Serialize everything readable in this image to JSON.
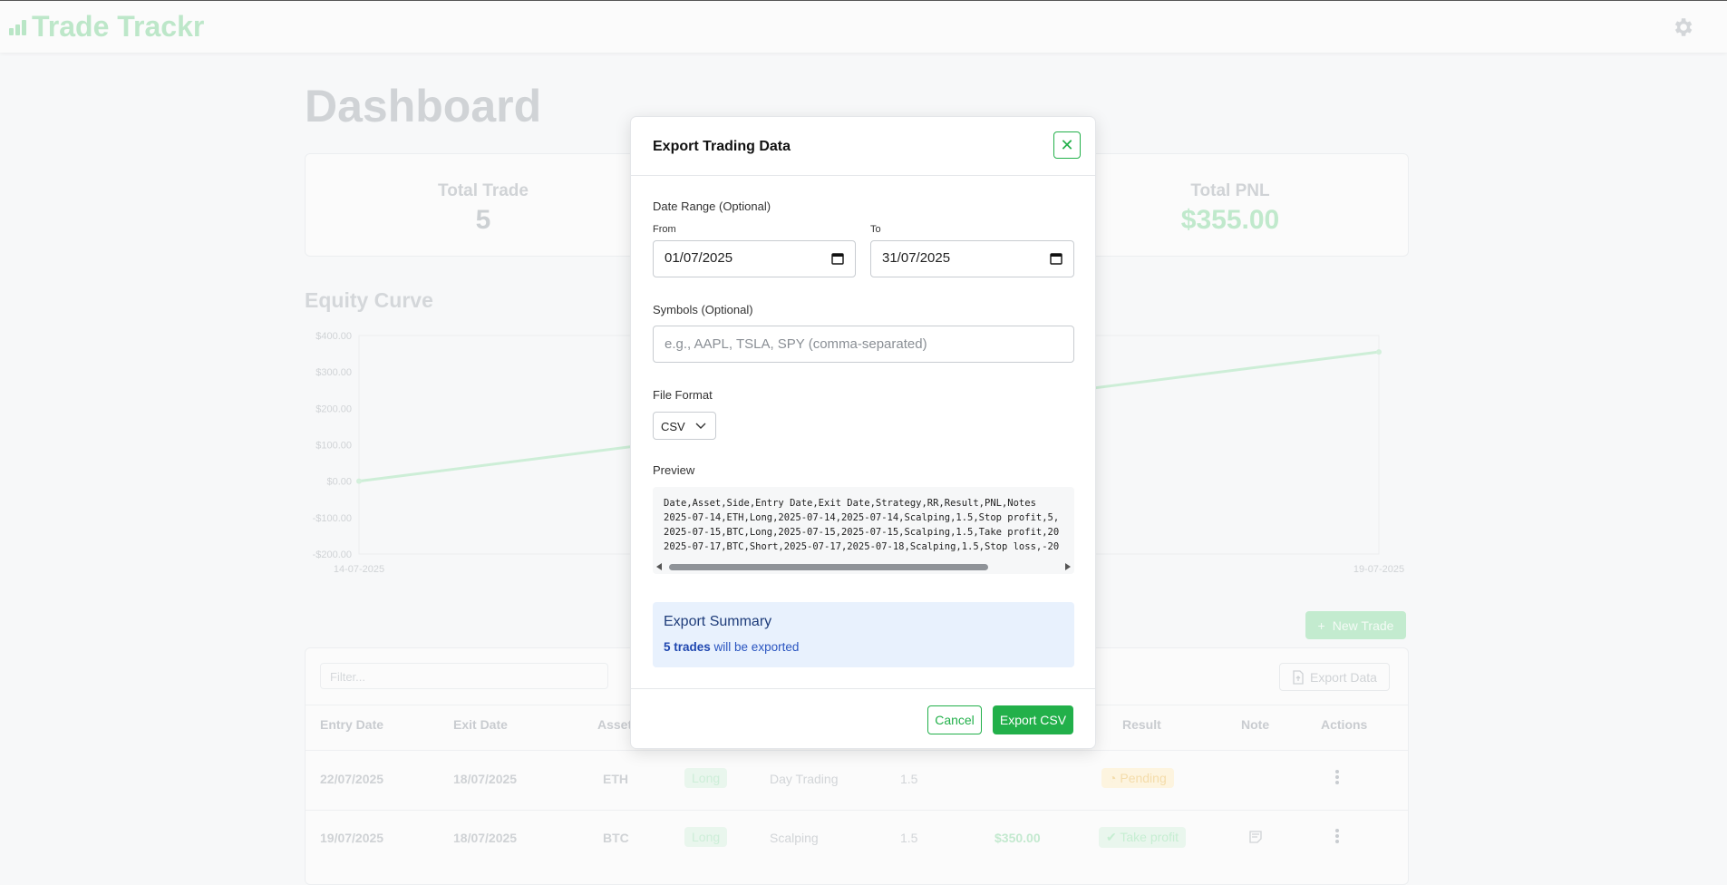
{
  "app": {
    "name": "Trade Trackr"
  },
  "page": {
    "title": "Dashboard"
  },
  "stats": [
    {
      "label": "Total Trade",
      "value": "5"
    },
    {
      "label": "Total PNL",
      "value": "$355.00"
    }
  ],
  "equity": {
    "title": "Equity Curve",
    "y_ticks": [
      "$400.00",
      "$300.00",
      "$200.00",
      "$100.00",
      "$0.00",
      "-$100.00",
      "-$200.00"
    ],
    "x_ticks": [
      "14-07-2025",
      "19-07-2025"
    ]
  },
  "chart_data": {
    "type": "line",
    "title": "Equity Curve",
    "x": [
      "14-07-2025",
      "19-07-2025"
    ],
    "series": [
      {
        "values": [
          0,
          355
        ]
      }
    ],
    "ylim": [
      -200,
      400
    ]
  },
  "table": {
    "new_trade_label": "New Trade",
    "filter_placeholder": "Filter...",
    "export_data_label": "Export Data",
    "headers": [
      "Entry Date",
      "Exit Date",
      "Asset",
      "Result",
      "Note",
      "Actions"
    ],
    "rows": [
      {
        "entry": "22/07/2025",
        "exit": "18/07/2025",
        "asset": "ETH",
        "side": "Long",
        "strategy": "Day Trading",
        "rr": "1.5",
        "pnl": "",
        "result": "Pending"
      },
      {
        "entry": "19/07/2025",
        "exit": "18/07/2025",
        "asset": "BTC",
        "side": "Long",
        "strategy": "Scalping",
        "rr": "1.5",
        "pnl": "$350.00",
        "result": "Take profit"
      }
    ]
  },
  "modal": {
    "title": "Export Trading Data",
    "date_range_label": "Date Range (Optional)",
    "from_label": "From",
    "from_value": "01/07/2025",
    "to_label": "To",
    "to_value": "31/07/2025",
    "symbols_label": "Symbols (Optional)",
    "symbols_placeholder": "e.g., AAPL, TSLA, SPY (comma-separated)",
    "format_label": "File Format",
    "format_value": "CSV",
    "preview_label": "Preview",
    "preview_lines": [
      "Date,Asset,Side,Entry Date,Exit Date,Strategy,RR,Result,PNL,Notes",
      "2025-07-14,ETH,Long,2025-07-14,2025-07-14,Scalping,1.5,Stop profit,5,",
      "2025-07-15,BTC,Long,2025-07-15,2025-07-15,Scalping,1.5,Take profit,20",
      "2025-07-17,BTC,Short,2025-07-17,2025-07-18,Scalping,1.5,Stop loss,-20"
    ],
    "summary_title": "Export Summary",
    "summary_count": "5 trades",
    "summary_suffix": "will be exported",
    "cancel_label": "Cancel",
    "export_label": "Export CSV"
  },
  "colors": {
    "accent": "#22b04a",
    "summary_bg": "#e8f1fd"
  }
}
